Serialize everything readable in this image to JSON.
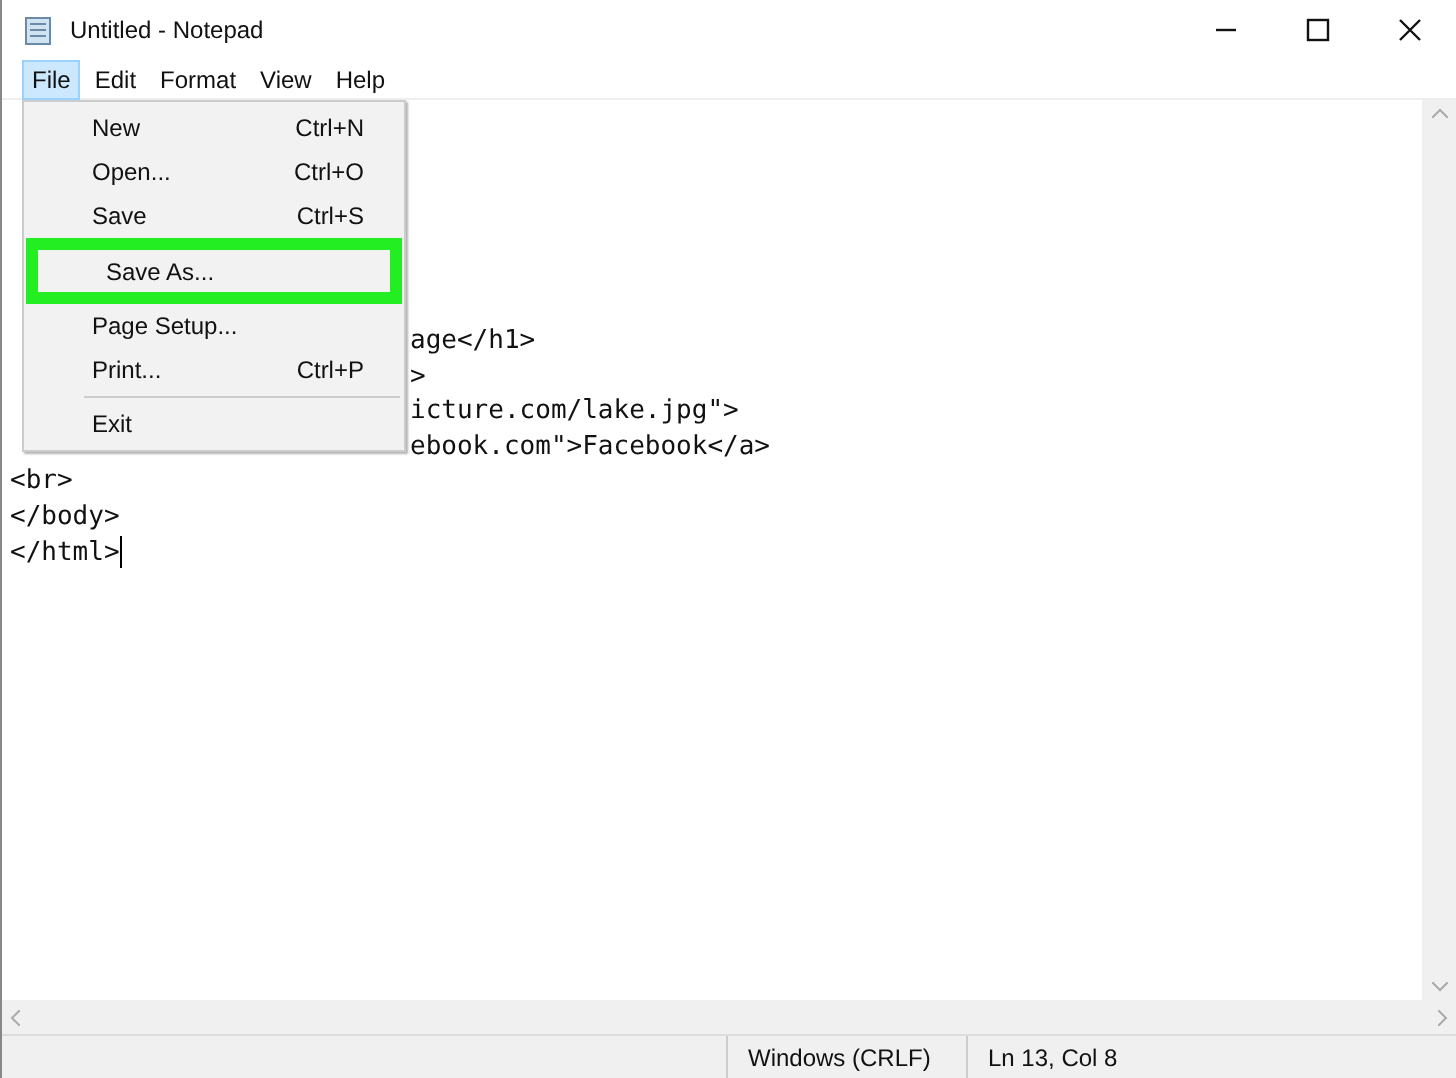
{
  "window": {
    "title": "Untitled - Notepad"
  },
  "menu_bar": [
    {
      "label": "File",
      "selected": true
    },
    {
      "label": "Edit",
      "selected": false
    },
    {
      "label": "Format",
      "selected": false
    },
    {
      "label": "View",
      "selected": false
    },
    {
      "label": "Help",
      "selected": false
    }
  ],
  "file_menu": [
    {
      "kind": "item",
      "label": "New",
      "shortcut": "Ctrl+N",
      "highlighted": false
    },
    {
      "kind": "item",
      "label": "Open...",
      "shortcut": "Ctrl+O",
      "highlighted": false
    },
    {
      "kind": "item",
      "label": "Save",
      "shortcut": "Ctrl+S",
      "highlighted": false
    },
    {
      "kind": "item",
      "label": "Save As...",
      "highlighted": true
    },
    {
      "kind": "item",
      "label": "Page Setup...",
      "highlighted": false
    },
    {
      "kind": "item",
      "label": "Print...",
      "shortcut": "Ctrl+P",
      "highlighted": false
    },
    {
      "kind": "separator"
    },
    {
      "kind": "item",
      "label": "Exit",
      "highlighted": false
    }
  ],
  "editor": {
    "lines": [
      {
        "text": "age</h1>",
        "covered": true
      },
      {
        "text": ">",
        "covered": true
      },
      {
        "text": "icture.com/lake.jpg\">",
        "covered": true
      },
      {
        "text": "ebook.com\">Facebook</a>",
        "covered": true
      },
      {
        "text": "<br>"
      },
      {
        "text": "</body>"
      },
      {
        "text": "</html>",
        "cursor": true
      }
    ]
  },
  "status_bar": [
    "Windows (CRLF)",
    "Ln 13, Col 8"
  ]
}
